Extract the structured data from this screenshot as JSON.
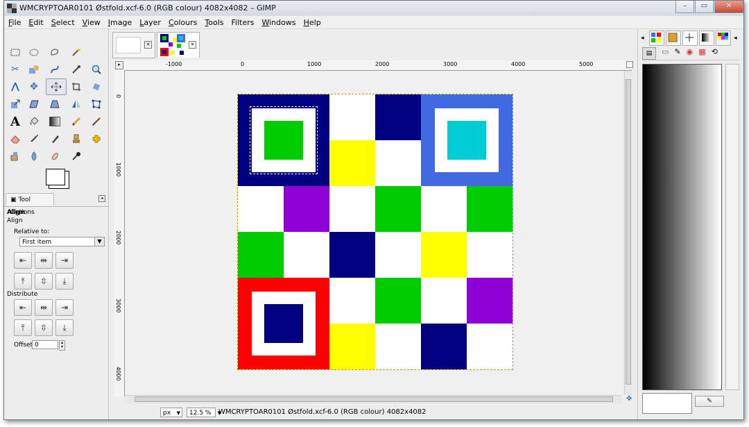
{
  "window": {
    "title": "WMCRYPTOAR0101 Østfold.xcf-6.0 (RGB colour) 4082x4082 – GIMP",
    "minimize": "–",
    "maximize": "▭",
    "close": "✕"
  },
  "menu": [
    "File",
    "Edit",
    "Select",
    "View",
    "Image",
    "Layer",
    "Colours",
    "Tools",
    "Filters",
    "Windows",
    "Help"
  ],
  "menu_underline": [
    "F",
    "E",
    "S",
    "V",
    "I",
    "L",
    "C",
    "T",
    "",
    "W",
    "H"
  ],
  "menu_rest": [
    "ile",
    "dit",
    "elect",
    "iew",
    "mage",
    "ayer",
    "olours",
    "ools",
    "Filters",
    "indows",
    "elp"
  ],
  "tool_options": {
    "tab_label": "Tool Options",
    "heading": "Align",
    "subheading": "Align",
    "relative_to_label": "Relative to:",
    "relative_to_value": "First item",
    "distribute_label": "Distribute",
    "offset_label": "Offset:",
    "offset_value": "0"
  },
  "ruler": {
    "top": [
      "-1000",
      "0",
      "1000",
      "2000",
      "3000",
      "4000",
      "5000"
    ],
    "left": [
      "0",
      "1000",
      "2000",
      "3000",
      "4000"
    ]
  },
  "status": {
    "unit": "px",
    "zoom": "12.5 %",
    "text": "WMCRYPTOAR0101 Østfold.xcf-6.0 (RGB colour) 4082x4082"
  },
  "colors": {
    "navy": "#000080",
    "yellow": "#ffff00",
    "green": "#00cc00",
    "blue": "#4169e1",
    "cyan": "#00ccd4",
    "purple": "#8f00d7",
    "red": "#ff0000",
    "white": "#ffffff"
  },
  "grid": [
    [
      "F",
      "F",
      "white",
      "navy",
      "B",
      "B"
    ],
    [
      "F",
      "F",
      "yellow",
      "white",
      "B",
      "B"
    ],
    [
      "white",
      "purple",
      "white",
      "green",
      "white",
      "green"
    ],
    [
      "green",
      "white",
      "navy",
      "white",
      "yellow",
      "white"
    ],
    [
      "R",
      "R",
      "white",
      "green",
      "white",
      "purple"
    ],
    [
      "R",
      "R",
      "yellow",
      "white",
      "navy",
      "white"
    ]
  ]
}
